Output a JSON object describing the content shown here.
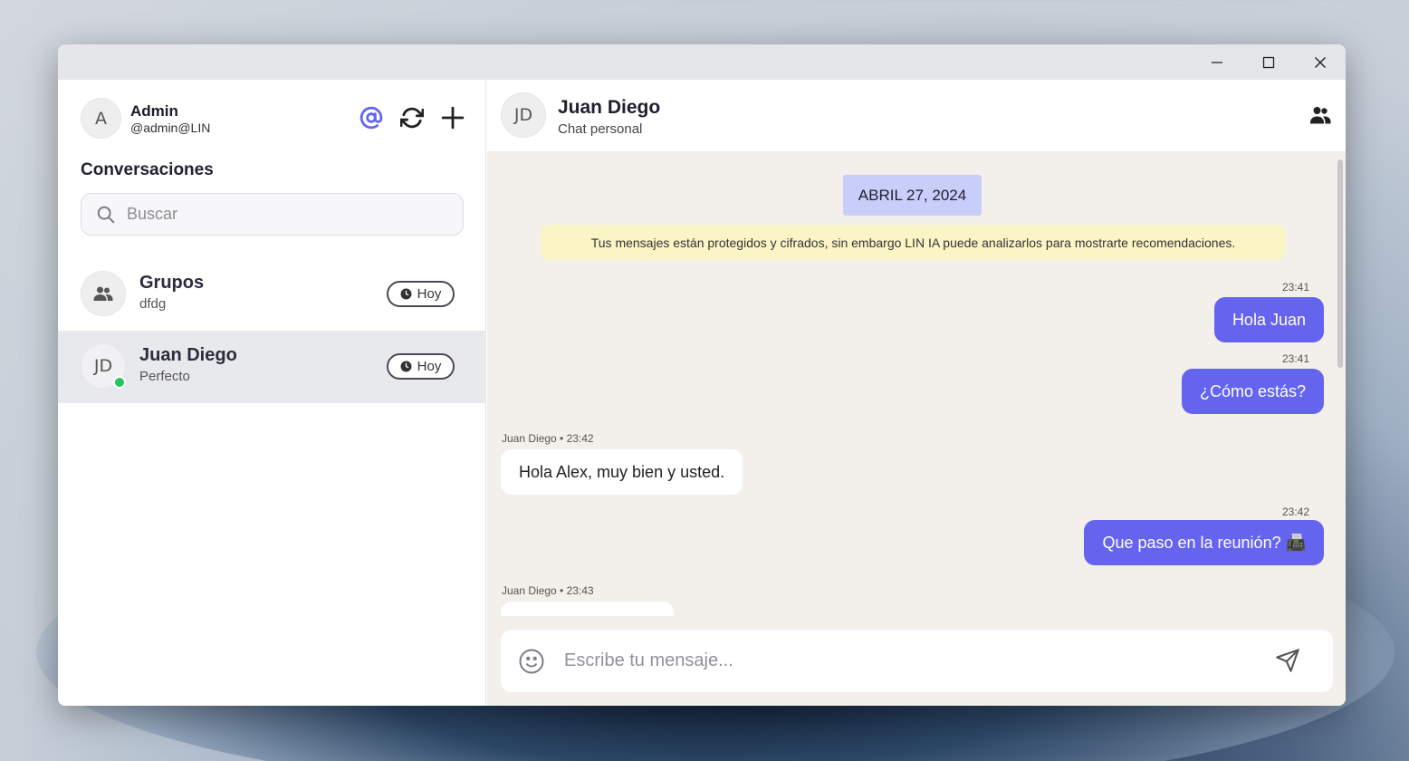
{
  "window": {
    "minimize_icon": "minimize-icon",
    "maximize_icon": "maximize-icon",
    "close_icon": "close-icon"
  },
  "sidebar": {
    "user": {
      "initial": "A",
      "name": "Admin",
      "handle": "@admin@LIN"
    },
    "actions": [
      "at-sign-icon",
      "refresh-icon",
      "plus-icon"
    ],
    "section_title": "Conversaciones",
    "search": {
      "placeholder": "Buscar",
      "value": ""
    },
    "conversations": [
      {
        "name": "Grupos",
        "preview": "dfdg",
        "time": "Hoy",
        "icon": "group-icon",
        "active": false
      },
      {
        "name": "Juan Diego",
        "preview": "Perfecto",
        "time": "Hoy",
        "initials": "JD",
        "online": true,
        "active": true
      }
    ]
  },
  "chat": {
    "header": {
      "initials": "JD",
      "title": "Juan Diego",
      "subtitle": "Chat personal",
      "members_icon": "members-icon"
    },
    "date_chip": "ABRIL 27, 2024",
    "notice": "Tus mensajes están protegidos y cifrados, sin embargo LIN IA puede analizarlos para mostrarte recomendaciones.",
    "messages": [
      {
        "direction": "out",
        "meta": "23:41",
        "text": "Hola Juan"
      },
      {
        "direction": "out",
        "meta": "23:41",
        "text": "¿Cómo estás?"
      },
      {
        "direction": "in",
        "meta": "Juan Diego • 23:42",
        "text": "Hola Alex, muy bien y usted."
      },
      {
        "direction": "out",
        "meta": "23:42",
        "text": "Que paso en la reunión? 📠"
      },
      {
        "direction": "in",
        "meta": "Juan Diego • 23:43",
        "text": ""
      }
    ],
    "composer": {
      "placeholder": "Escribe tu mensaje...",
      "value": ""
    }
  },
  "colors": {
    "accent": "#6464ef",
    "date_chip": "#c9cdf9",
    "notice_bg": "#fbf5c6",
    "chat_bg": "#f3efea",
    "online": "#22c55e"
  }
}
